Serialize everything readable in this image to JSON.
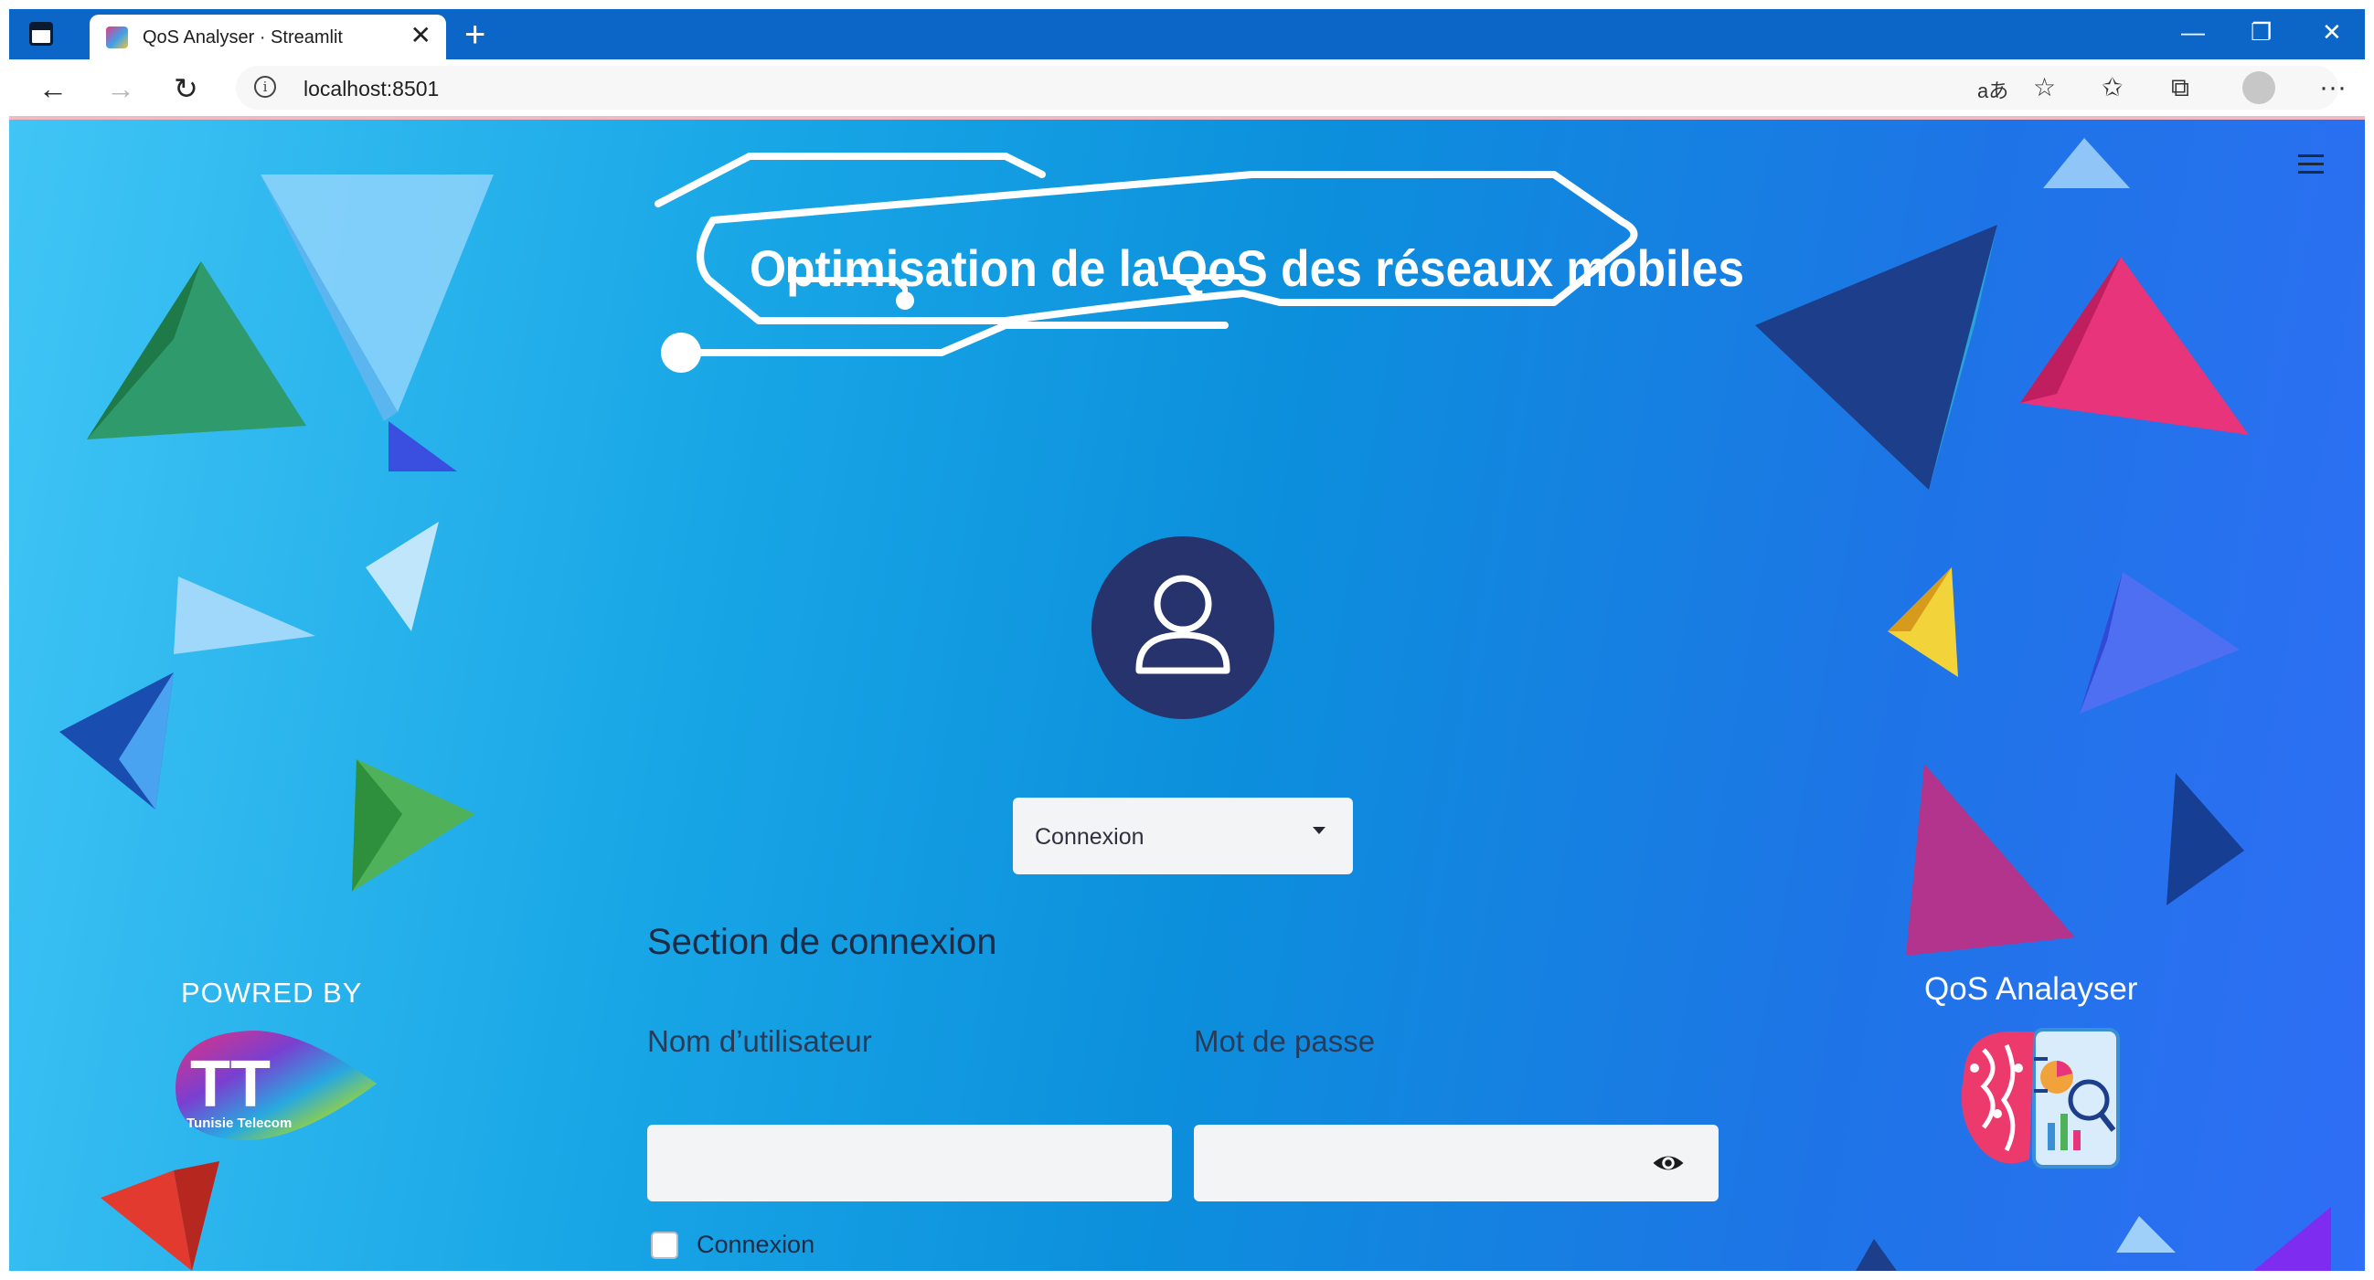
{
  "browser": {
    "tab_title": "QoS Analyser · Streamlit",
    "tab_close": "✕",
    "new_tab": "+",
    "url": "localhost:8501",
    "read_aloud_icon": "aあ",
    "window_controls": {
      "minimize": "—",
      "maximize": "❐",
      "close": "✕"
    },
    "nav": {
      "back": "←",
      "forward": "→",
      "reload": "↻"
    },
    "more": "···",
    "accent_color": "#0c66c8"
  },
  "banner": {
    "title": "Optimisation de la QoS des réseaux mobiles"
  },
  "login": {
    "mode_select": {
      "value": "Connexion"
    },
    "section_title": "Section de connexion",
    "username_label": "Nom d’utilisateur",
    "password_label": "Mot de passe",
    "username_value": "",
    "password_value": "",
    "checkbox_label": "Connexion",
    "checkbox_checked": false
  },
  "left_panel": {
    "powered_by": "POWRED BY",
    "logo_text": "Tunisie Telecom"
  },
  "right_panel": {
    "app_name": "QoS Analayser"
  },
  "colors": {
    "avatar_bg": "#27336d",
    "page_gradient": [
      "#40c5f5",
      "#0c8fdc",
      "#2f6ef6"
    ]
  }
}
